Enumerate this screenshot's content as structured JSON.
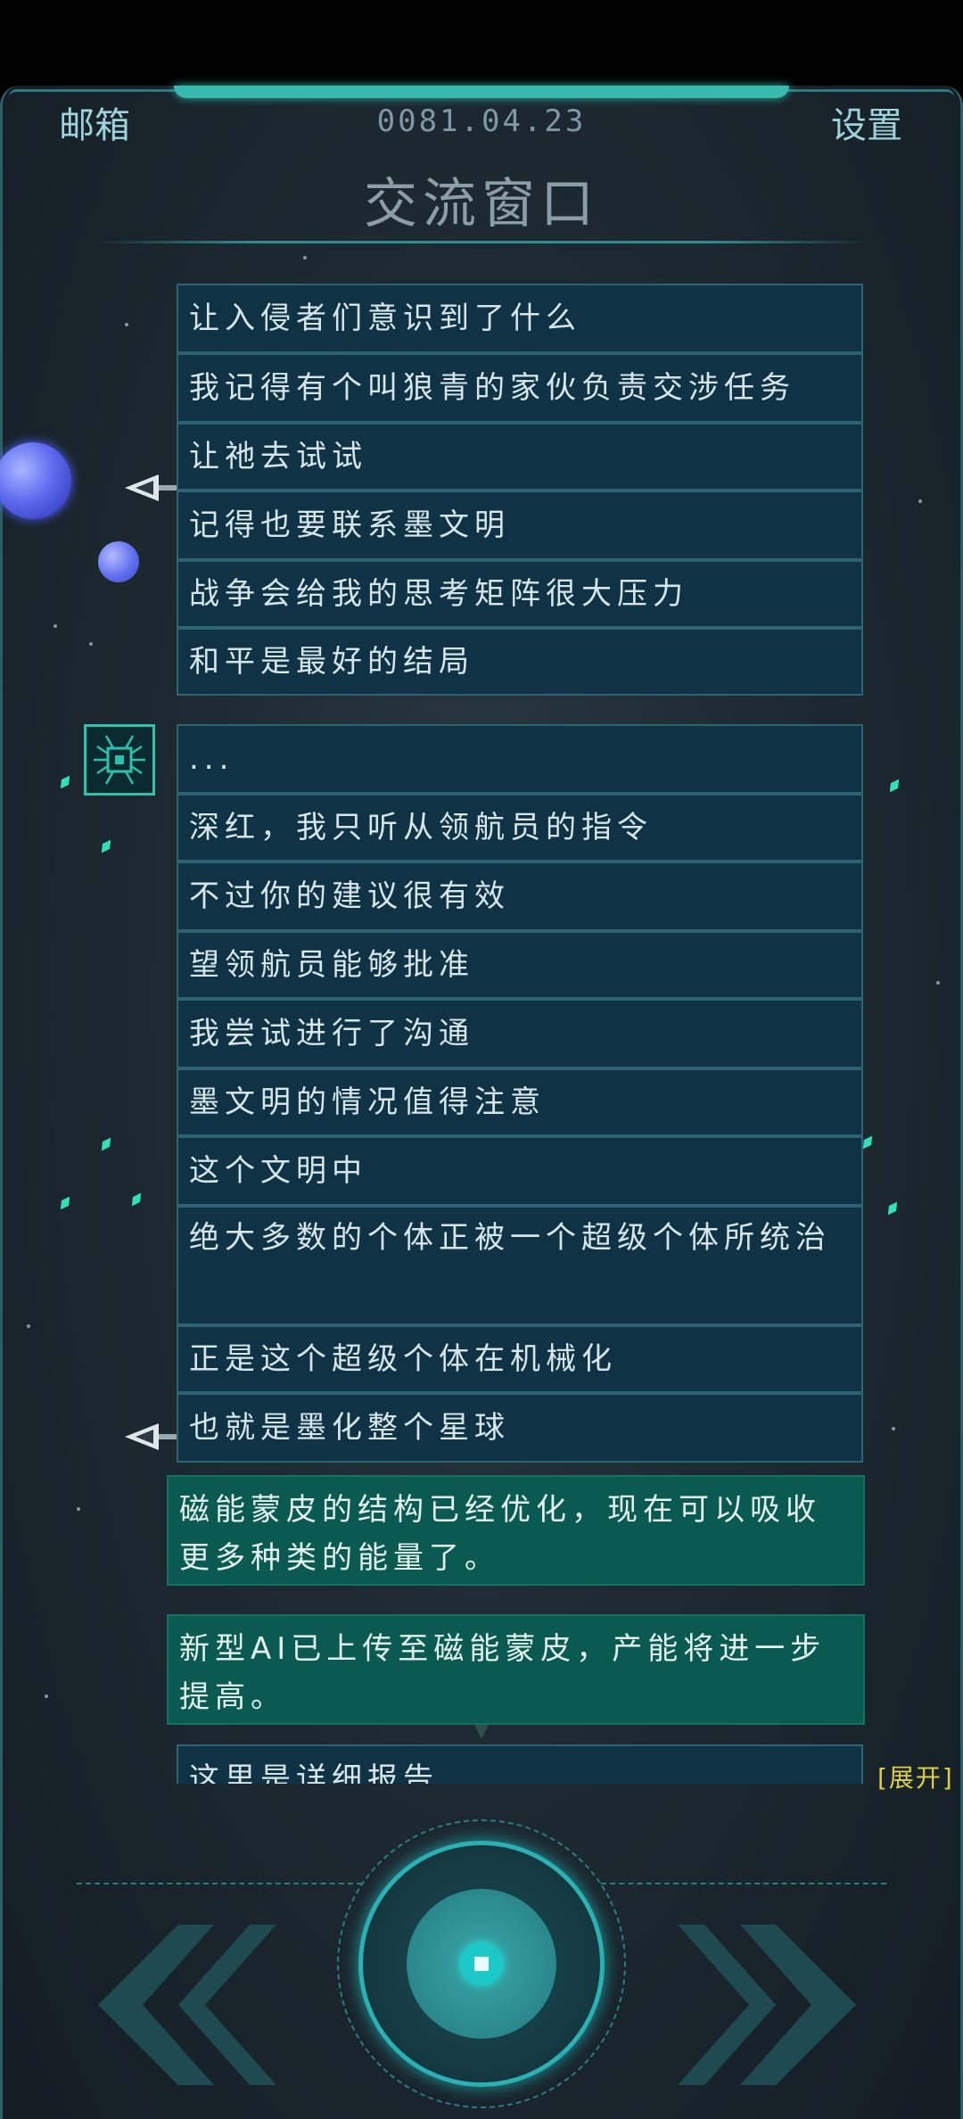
{
  "header": {
    "mailbox_label": "邮箱",
    "date": "0081.04.23",
    "settings_label": "设置",
    "title": "交流窗口"
  },
  "messages": [
    {
      "text": "让入侵者们意识到了什么"
    },
    {
      "text": "我记得有个叫狼青的家伙负责交涉任务"
    },
    {
      "text": "让祂去试试"
    },
    {
      "text": "记得也要联系墨文明"
    },
    {
      "text": "战争会给我的思考矩阵很大压力"
    },
    {
      "text": "和平是最好的结局"
    },
    {
      "text": "..."
    },
    {
      "text": "深红，我只听从领航员的指令"
    },
    {
      "text": "不过你的建议很有效"
    },
    {
      "text": "望领航员能够批准"
    },
    {
      "text": "我尝试进行了沟通"
    },
    {
      "text": "墨文明的情况值得注意"
    },
    {
      "text": "这个文明中"
    },
    {
      "text": "绝大多数的个体正被一个超级个体所统治"
    },
    {
      "text": "正是这个超级个体在机械化"
    },
    {
      "text": "也就是墨化整个星球"
    },
    {
      "text": "磁能蒙皮的结构已经优化，现在可以吸收更多种类的能量了。"
    },
    {
      "text": "新型AI已上传至磁能蒙皮，产能将进一步提高。"
    },
    {
      "text": "这里是详细报告"
    }
  ],
  "expand_label": "[展开]",
  "controls": {
    "prev_icon": "double-chevron-left-icon",
    "next_icon": "double-chevron-right-icon",
    "center_icon": "core-button-icon"
  },
  "colors": {
    "accent": "#2bb0b3",
    "message_bg": "#0f3344",
    "system_message_bg": "#0a5a52",
    "expand": "#e0d040"
  }
}
